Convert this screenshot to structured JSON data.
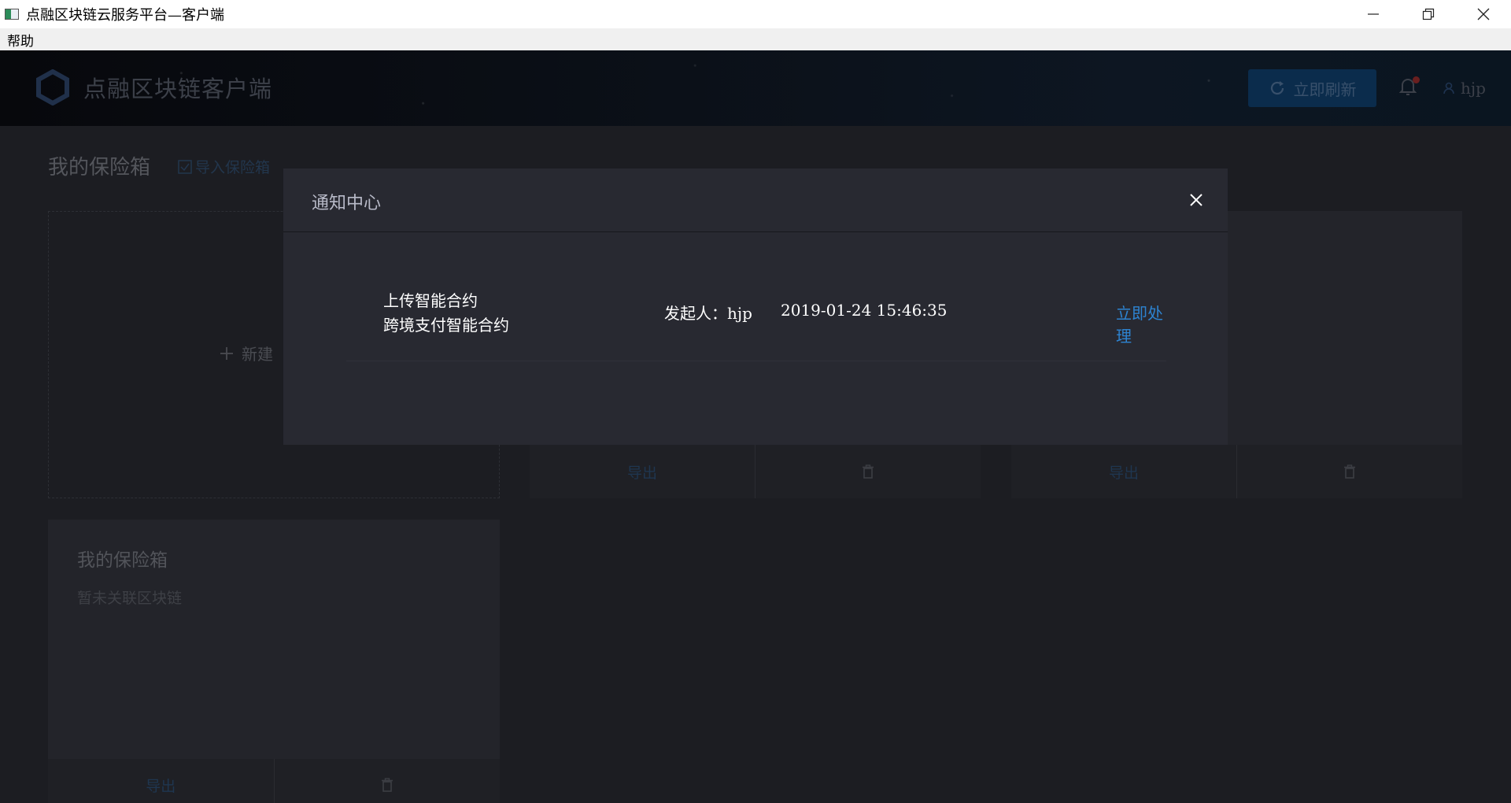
{
  "window": {
    "title": "点融区块链云服务平台—客户端",
    "controls": {
      "minimize": "minimize-icon",
      "restore": "restore-icon",
      "close": "close-icon"
    }
  },
  "menubar": {
    "help": "帮助"
  },
  "header": {
    "brand": "点融区块链客户端",
    "refresh_label": "立即刷新",
    "username": "hjp"
  },
  "page": {
    "title": "我的保险箱",
    "import_label": "导入保险箱",
    "new_card_label": "新建",
    "cards": [
      {
        "export_label": "导出"
      },
      {
        "export_label": "导出"
      },
      {
        "title": "我的保险箱",
        "subtitle": "暂未关联区块链",
        "export_label": "导出"
      }
    ]
  },
  "modal": {
    "title": "通知中心",
    "notifications": [
      {
        "type": "上传智能合约",
        "name": "跨境支付智能合约",
        "sender": "发起人：hjp",
        "time": "2019-01-24 15:46:35",
        "action": "立即处理"
      }
    ]
  },
  "colors": {
    "accent": "#2d83d1",
    "modal_bg": "#282931",
    "page_bg": "#1c1d22"
  }
}
